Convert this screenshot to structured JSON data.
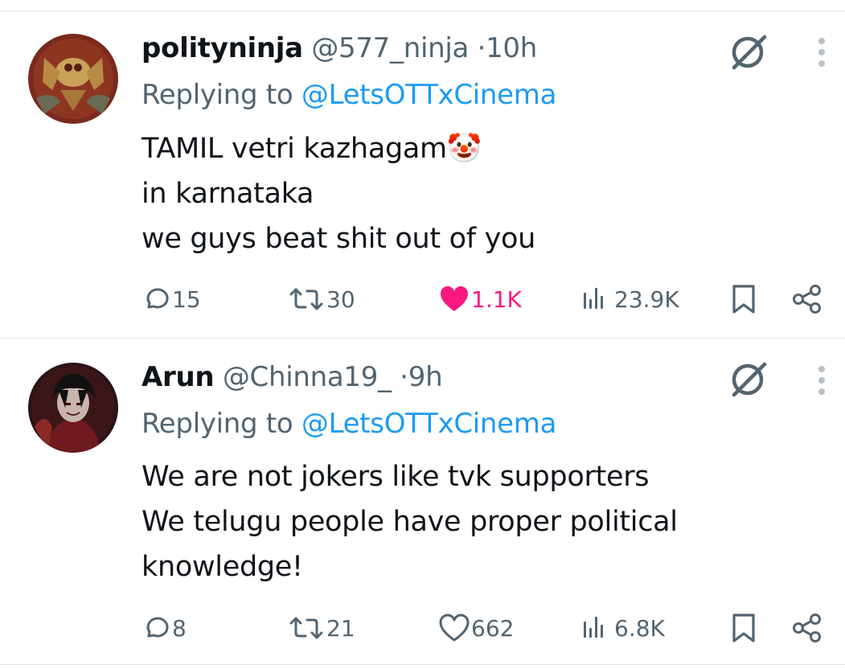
{
  "tweets": [
    {
      "name": "polityninja",
      "handle": "@577_ninja",
      "dot": "·",
      "time": "10h",
      "replying_prefix": "Replying to ",
      "replying_to": "@LetsOTTxCinema",
      "lines": [
        "TAMIL vetri kazhagam🤡",
        "in karnataka",
        "we guys beat shit out of you"
      ],
      "replies": "15",
      "reposts": "30",
      "likes": "1.1K",
      "liked": true,
      "views": "23.9K"
    },
    {
      "name": "Arun",
      "handle": "@Chinna19_",
      "dot": "·",
      "time": "9h",
      "replying_prefix": "Replying to ",
      "replying_to": "@LetsOTTxCinema",
      "lines": [
        "We are not jokers like tvk supporters",
        "We telugu people have proper political",
        "knowledge!"
      ],
      "replies": "8",
      "reposts": "21",
      "likes": "662",
      "liked": false,
      "views": "6.8K"
    }
  ],
  "colors": {
    "text": "#0f1419",
    "secondary": "#536471",
    "link": "#1d9bf0",
    "like": "#f91880"
  }
}
